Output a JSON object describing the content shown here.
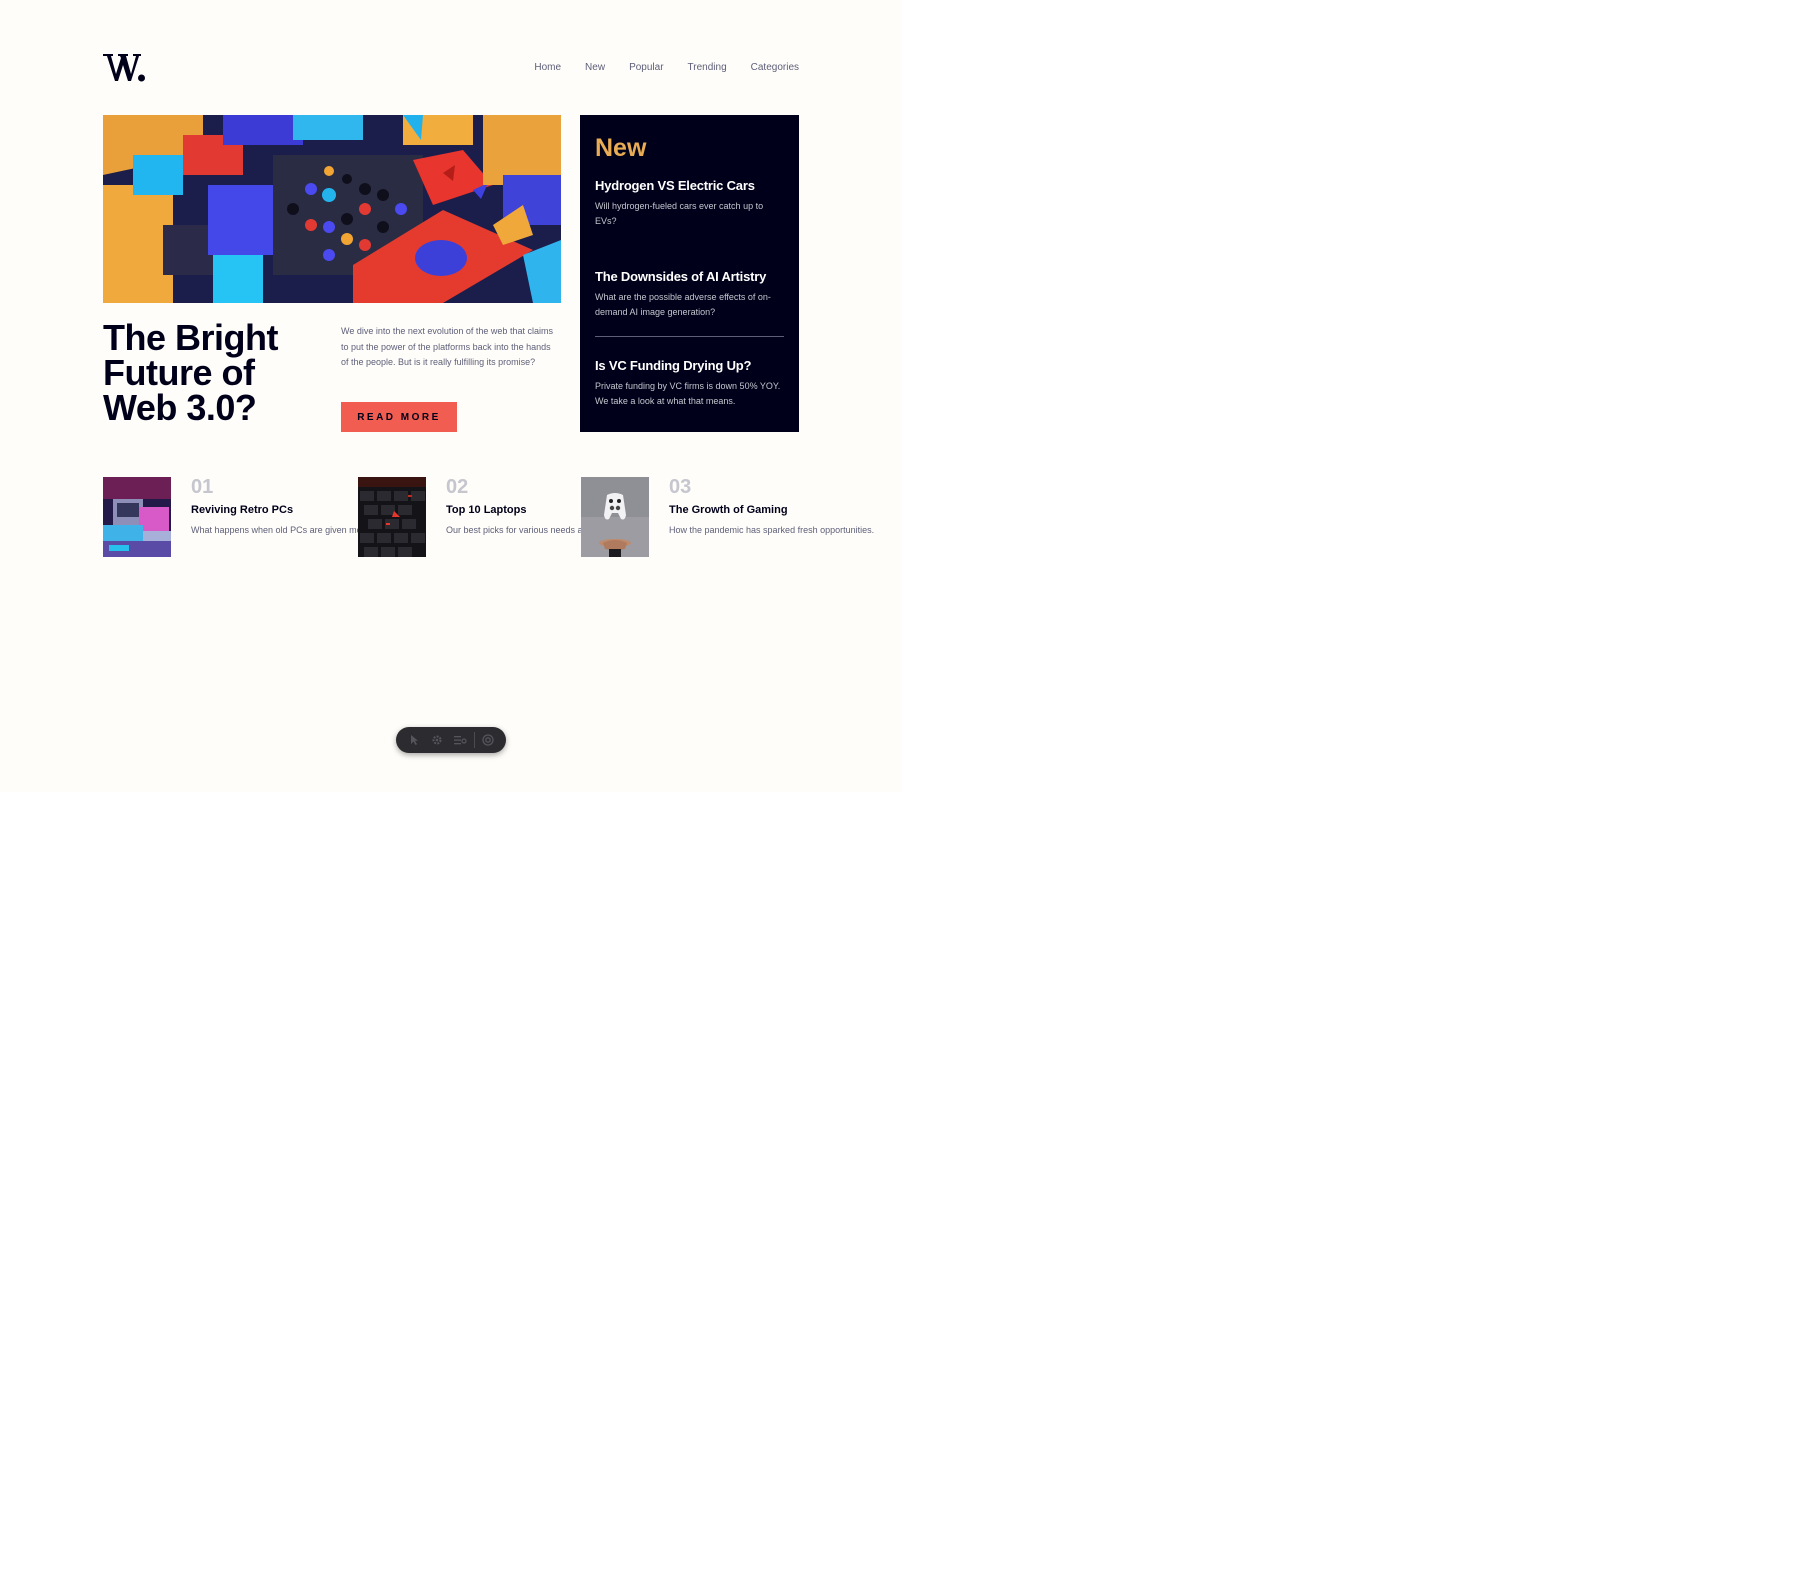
{
  "header": {
    "logo_text": "W.",
    "nav": [
      "Home",
      "New",
      "Popular",
      "Trending",
      "Categories"
    ]
  },
  "hero": {
    "title": "The Bright Future of Web 3.0?",
    "description": "We dive into the next evolution of the web that claims to put the power of the platforms back into the hands of the people. But is it really fulfilling its promise?",
    "button_label": "READ MORE"
  },
  "new_panel": {
    "heading": "New",
    "items": [
      {
        "title": "Hydrogen VS Electric Cars",
        "desc": "Will hydrogen-fueled cars ever catch up to EVs?"
      },
      {
        "title": "The Downsides of AI Artistry",
        "desc": "What are the possible adverse effects of on-demand AI image generation?"
      },
      {
        "title": "Is VC Funding Drying Up?",
        "desc": "Private funding by VC firms is down 50% YOY. We take a look at what that means."
      }
    ]
  },
  "articles": [
    {
      "num": "01",
      "title": "Reviving Retro PCs",
      "desc": "What happens when old PCs are given modern upgrades?"
    },
    {
      "num": "02",
      "title": "Top 10 Laptops",
      "desc": "Our best picks for various needs and budgets."
    },
    {
      "num": "03",
      "title": "The Growth of Gaming",
      "desc": "How the pandemic has sparked fresh opportunities."
    }
  ],
  "toolbar": {
    "icons": [
      "inspect-icon",
      "settings-icon",
      "list-icon",
      "target-icon"
    ]
  },
  "colors": {
    "page_bg": "#fffdf9",
    "dark": "#00001a",
    "accent_red": "#f15d51",
    "accent_orange": "#e9ab53",
    "grey_blue": "#5d5f79",
    "grey": "#c5c6ce"
  }
}
